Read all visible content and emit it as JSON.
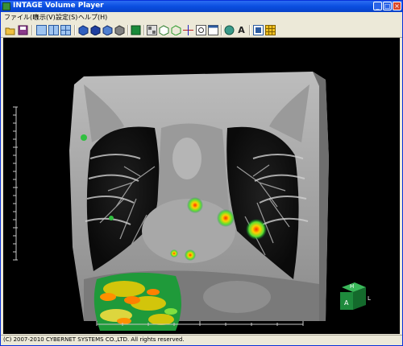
{
  "window": {
    "title": "INTAGE Volume Player"
  },
  "window_controls": {
    "minimize": "_",
    "maximize": "□",
    "close": "×"
  },
  "menu": [
    "ファイル(F)",
    "表示(V)",
    "設定(S)",
    "ヘルプ(H)"
  ],
  "toolbar": {
    "buttons": [
      "open-icon",
      "save-icon",
      "layout-single-icon",
      "layout-dual-icon",
      "layout-quad-icon",
      "cube-blue-icon",
      "cube-blue-dark-icon",
      "cube-front-icon",
      "cube-gray-icon",
      "green-square-icon",
      "mpr-icon",
      "volume-icon",
      "clip-cube-icon",
      "crosshair-icon",
      "roi-icon",
      "window-icon",
      "sphere-icon",
      "annotation-icon",
      "screenshot-icon",
      "grid-icon"
    ],
    "annotation_glyph": "A"
  },
  "orientation_cube": {
    "top": "H",
    "front": "A",
    "side": "L",
    "color": "#1e8a3c"
  },
  "status": {
    "text": "(C) 2007-2010 CYBERNET SYSTEMS CO.,LTD. All rights reserved."
  }
}
